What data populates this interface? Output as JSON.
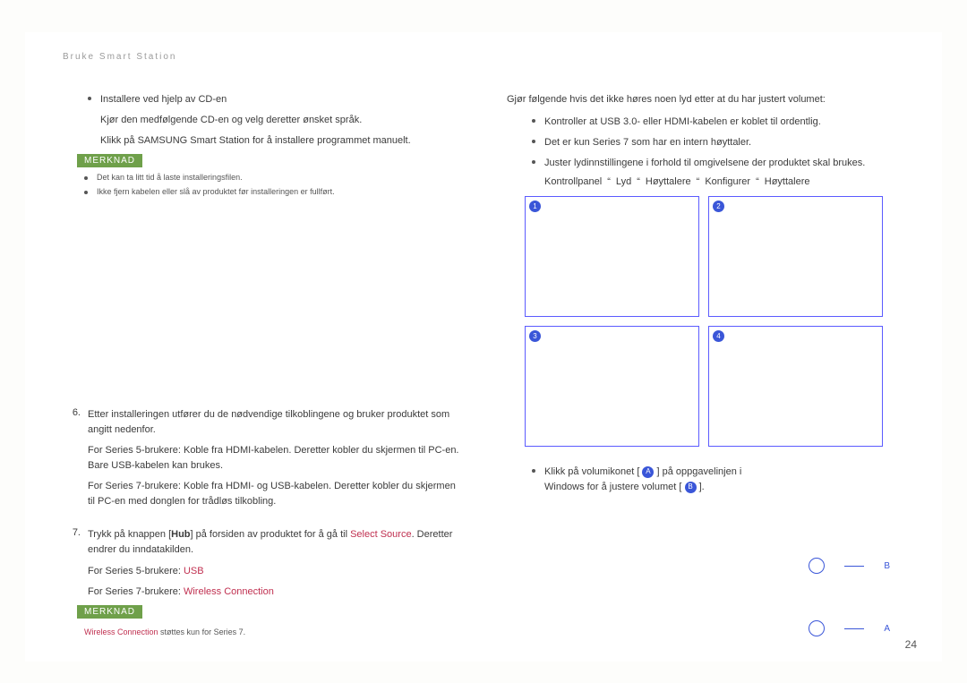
{
  "breadcrumb": "Bruke Smart Station",
  "pagenum": "24",
  "left": {
    "install_title": "Installere ved hjelp av CD-en",
    "install_p1": "Kjør den medfølgende CD-en og velg deretter ønsket språk.",
    "install_p2_a": "Klikk på ",
    "install_p2_b": "SAMSUNG Smart Station",
    "install_p2_c": " for å installere programmet manuelt.",
    "merknad": "MERKNAD",
    "note1": "Det kan ta litt tid å laste installeringsfilen.",
    "note2": "Ikke fjern kabelen eller slå av produktet før installeringen er fullført.",
    "item6_n": "6.",
    "item6": "Etter installeringen utfører du de nødvendige tilkoblingene og bruker produktet som angitt nedenfor.",
    "item6_s5": "For Series 5-brukere: Koble fra HDMI-kabelen. Deretter kobler du skjermen til PC-en. Bare USB-kabelen kan brukes.",
    "item6_s7": "For Series 7-brukere: Koble fra HDMI- og USB-kabelen. Deretter kobler du skjermen til PC-en med donglen for trådløs tilkobling.",
    "item7_n": "7.",
    "item7_a": "Trykk på knappen [",
    "item7_hub": "Hub",
    "item7_b": "] på forsiden av produktet for å gå til ",
    "item7_src": "Select Source",
    "item7_c": ". Deretter endrer du inndatakilden.",
    "item7_s5_a": "For Series 5-brukere: ",
    "item7_s5_b": "USB",
    "item7_s7_a": "For Series 7-brukere: ",
    "item7_s7_b": "Wireless Connection",
    "note3_a": "Wireless Connection",
    "note3_b": " støttes kun for Series 7."
  },
  "right": {
    "heading": "Gjør følgende hvis det ikke høres noen lyd etter at du har justert volumet:",
    "b1": "Kontroller at USB 3.0- eller HDMI-kabelen er koblet til ordentlig.",
    "b2": "Det er kun Series 7 som har en intern høyttaler.",
    "b3": "Juster lydinnstillingene i forhold til omgivelsene der produktet skal brukes.",
    "path_a": "Kontrollpanel",
    "path_b": "Lyd",
    "path_c": "Høyttalere",
    "path_d": "Konﬁgurer",
    "path_e": "Høyttalere",
    "grid": [
      "1",
      "2",
      "3",
      "4"
    ],
    "vol_a": "Klikk på volumikonet [",
    "vol_A": "A",
    "vol_b": "] på oppgavelinjen i",
    "vol_c": "Windows for å justere volumet [",
    "vol_B": "B",
    "vol_d": "].",
    "legendB": "B",
    "legendA": "A"
  }
}
